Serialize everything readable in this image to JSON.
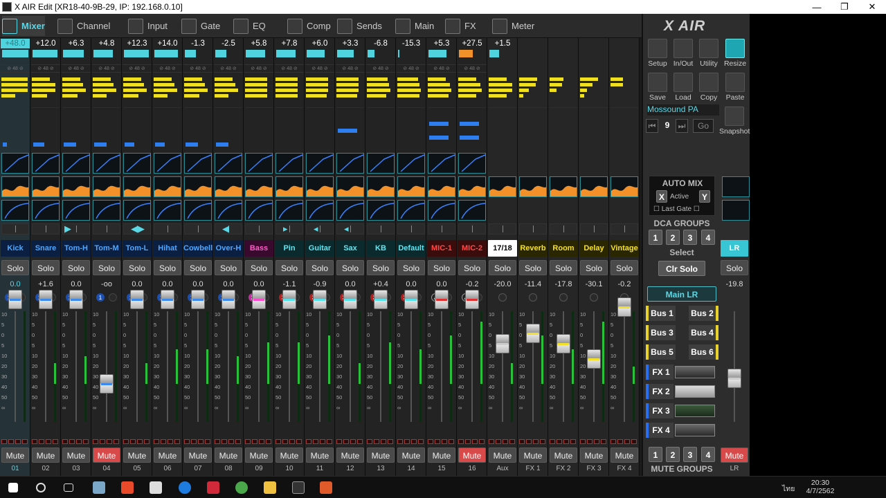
{
  "window": {
    "title": "X AIR Edit [XR18-40-9B-29, IP: 192.168.0.10]",
    "min": "—",
    "max": "❐",
    "close": "✕"
  },
  "tabs": [
    {
      "label": "Mixer"
    },
    {
      "label": "Channel"
    },
    {
      "label": "Input"
    },
    {
      "label": "Gate"
    },
    {
      "label": "EQ"
    },
    {
      "label": "Comp"
    },
    {
      "label": "Sends"
    },
    {
      "label": "Main"
    },
    {
      "label": "FX"
    },
    {
      "label": "Meter"
    }
  ],
  "strips": [
    {
      "gain": "+48.0",
      "name": "Kick",
      "gainval": "0.0",
      "dca": "1",
      "num": "01",
      "mute": false
    },
    {
      "gain": "+12.0",
      "name": "Snare",
      "gainval": "+1.6",
      "dca": "1",
      "num": "02",
      "mute": false
    },
    {
      "gain": "+6.3",
      "name": "Tom-H",
      "gainval": "0.0",
      "dca": "1",
      "num": "03",
      "mute": false
    },
    {
      "gain": "+4.8",
      "name": "Tom-M",
      "gainval": "-oo",
      "dca": "1",
      "num": "04",
      "mute": true
    },
    {
      "gain": "+12.3",
      "name": "Tom-L",
      "gainval": "0.0",
      "dca": "1",
      "num": "05",
      "mute": false
    },
    {
      "gain": "+14.0",
      "name": "Hihat",
      "gainval": "0.0",
      "dca": "1",
      "num": "06",
      "mute": false
    },
    {
      "gain": "-1.3",
      "name": "Cowbell",
      "gainval": "0.0",
      "dca": "1",
      "num": "07",
      "mute": false
    },
    {
      "gain": "-2.5",
      "name": "Over-H",
      "gainval": "0.0",
      "dca": "1",
      "num": "08",
      "mute": false
    },
    {
      "gain": "+5.8",
      "name": "Bass",
      "gainval": "0.0",
      "dca": "2",
      "num": "09",
      "mute": false
    },
    {
      "gain": "+7.8",
      "name": "Pin",
      "gainval": "-1.1",
      "dca": "3",
      "num": "10",
      "mute": false
    },
    {
      "gain": "+6.0",
      "name": "Guitar",
      "gainval": "-0.9",
      "dca": "3",
      "num": "11",
      "mute": false
    },
    {
      "gain": "+3.3",
      "name": "Sax",
      "gainval": "0.0",
      "dca": "3",
      "num": "12",
      "mute": false
    },
    {
      "gain": "-6.8",
      "name": "KB",
      "gainval": "+0.4",
      "dca": "3",
      "num": "13",
      "mute": false
    },
    {
      "gain": "-15.3",
      "name": "Default",
      "gainval": "0.0",
      "dca": "3",
      "num": "14",
      "mute": false
    },
    {
      "gain": "+5.3",
      "name": "MIC-1",
      "gainval": "0.0",
      "dca": "4",
      "num": "15",
      "mute": false
    },
    {
      "gain": "+27.5",
      "name": "MIC-2",
      "gainval": "-0.2",
      "dca": "4",
      "num": "16",
      "mute": true
    },
    {
      "gain": "+1.5",
      "name": "17/18",
      "gainval": "-20.0",
      "dca": "",
      "num": "Aux",
      "mute": false
    },
    {
      "gain": "",
      "name": "Reverb",
      "gainval": "-11.4",
      "dca": "",
      "num": "FX 1",
      "mute": false
    },
    {
      "gain": "",
      "name": "Room",
      "gainval": "-17.8",
      "dca": "",
      "num": "FX 2",
      "mute": false
    },
    {
      "gain": "",
      "name": "Delay",
      "gainval": "-30.1",
      "dca": "",
      "num": "FX 3",
      "mute": false
    },
    {
      "gain": "",
      "name": "Vintage",
      "gainval": "-0.2",
      "dca": "",
      "num": "FX 4",
      "mute": false
    }
  ],
  "labels": {
    "solo": "Solo",
    "mute": "Mute",
    "phantom": "48"
  },
  "scale": [
    "10",
    "5",
    "0",
    "5",
    "10",
    "20",
    "30",
    "40",
    "50",
    "∞"
  ],
  "right": {
    "logo": "X AIR",
    "tools": [
      "Setup",
      "In/Out",
      "Utility",
      "Resize",
      "Save",
      "Load",
      "Copy",
      "Paste"
    ],
    "scene_name": "Mossound PA",
    "scene_num": "9",
    "go": "Go",
    "snapshot": "Snapshot",
    "automix": {
      "title": "AUTO MIX",
      "x": "X",
      "active": "Active",
      "y": "Y",
      "last_gate": "Last Gate"
    },
    "dca_groups": "DCA GROUPS",
    "dca": [
      "1",
      "2",
      "3",
      "4"
    ],
    "select": "Select",
    "clr_solo": "Clr Solo",
    "main_lr": "Main LR",
    "buses": [
      "Bus 1",
      "Bus 2",
      "Bus 3",
      "Bus 4",
      "Bus 5",
      "Bus 6"
    ],
    "fx": [
      "FX 1",
      "FX 2",
      "FX 3",
      "FX 4"
    ],
    "mute_groups": "MUTE GROUPS",
    "mg": [
      "1",
      "2",
      "3",
      "4"
    ]
  },
  "lr": {
    "name": "LR",
    "solo": "Solo",
    "gainval": "-19.8",
    "mute": "Mute",
    "num": "LR"
  },
  "tray": {
    "time": "20:30",
    "date": "4/7/2562",
    "lang": "ไทย"
  }
}
